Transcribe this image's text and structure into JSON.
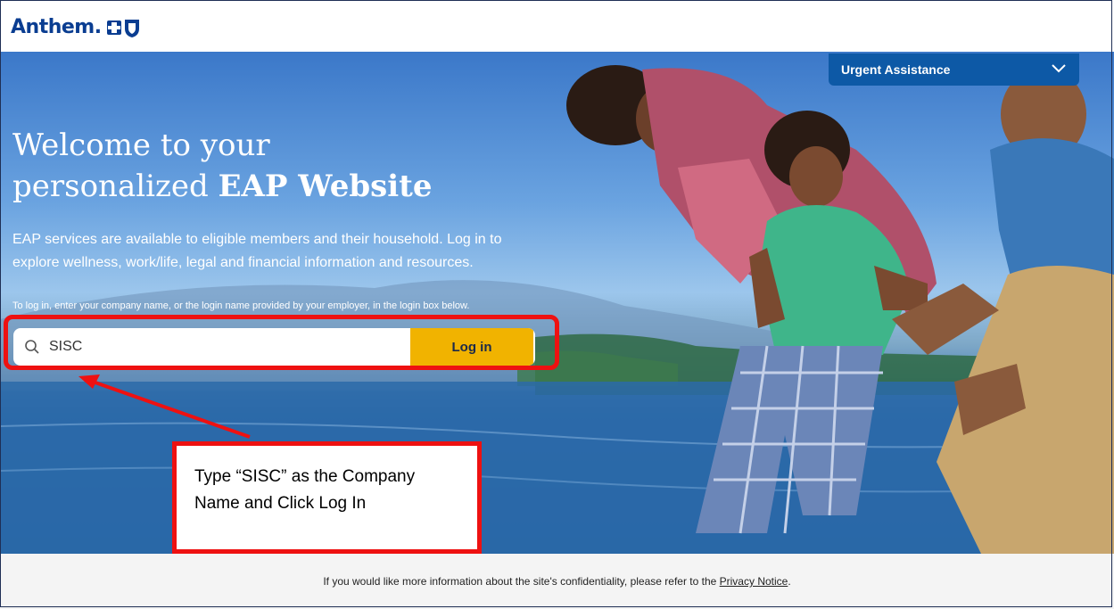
{
  "header": {
    "logo_text": "Anthem.",
    "brand_color": "#0a3d91"
  },
  "urgent": {
    "label": "Urgent Assistance",
    "icon": "chevron-down-icon",
    "bg_color": "#0d59a6"
  },
  "hero": {
    "title_line1": "Welcome to your",
    "title_line2_prefix": "personalized ",
    "title_line2_bold": "EAP Website",
    "intro": "EAP services are available to eligible members and their household. Log in to explore wellness, work/life, legal and financial information and resources.",
    "instructions": "To log in, enter your company name, or the login name provided by your employer, in the login box below."
  },
  "search": {
    "value": "SISC",
    "icon": "search-icon",
    "button_label": "Log in",
    "button_color": "#f1b300"
  },
  "annotation": {
    "text": "Type “SISC” as the Company Name and Click Log In",
    "highlight_color": "#ee1111"
  },
  "footer": {
    "text": "If you would like more information about the site's confidentiality, please refer to the ",
    "link": "Privacy Notice",
    "suffix": "."
  }
}
